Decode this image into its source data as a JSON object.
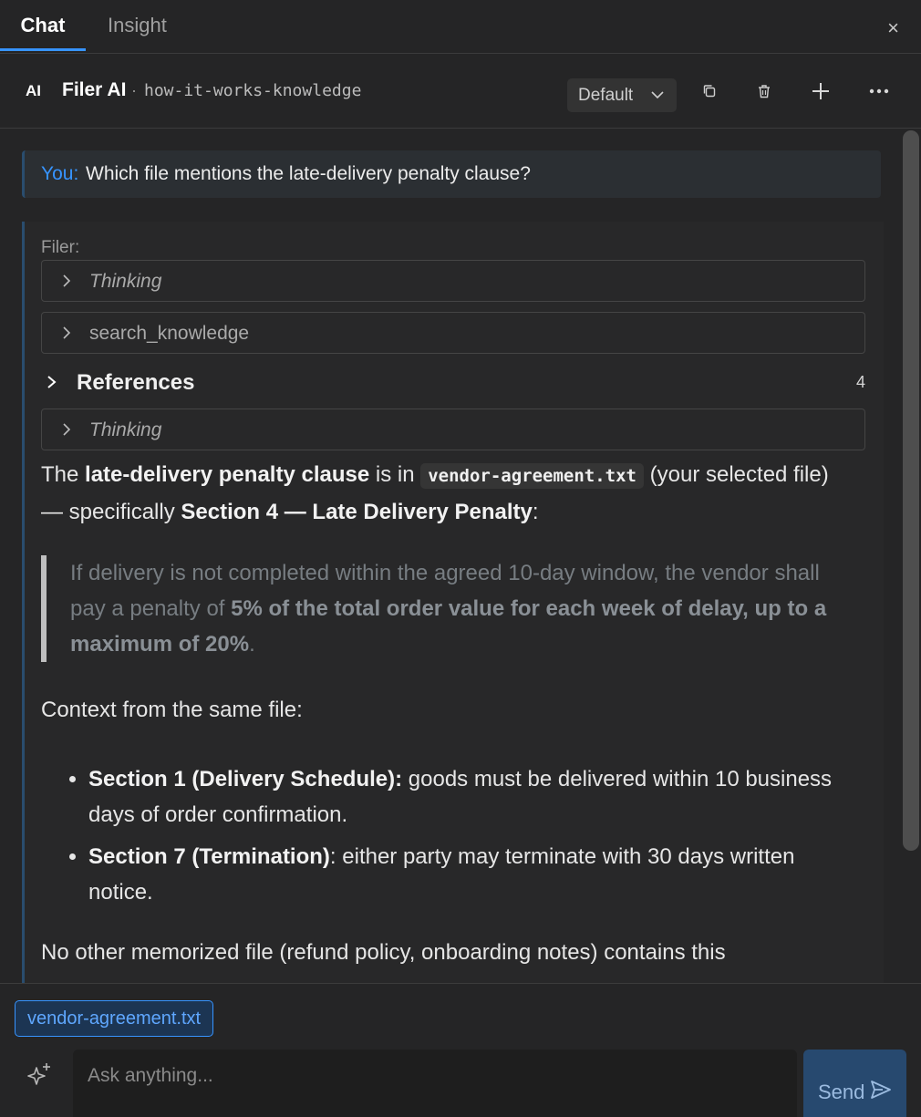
{
  "tabs": {
    "chat": "Chat",
    "insight": "Insight",
    "close": "×"
  },
  "header": {
    "ai_badge": "AI",
    "bot_name": "Filer AI",
    "separator": "·",
    "knowledge_base": "how-it-works-knowledge",
    "mode": "Default"
  },
  "user_message": {
    "prefix": "You:",
    "text": "Which file mentions the late-delivery penalty clause?"
  },
  "ai_message": {
    "sender": "Filer:",
    "thinking_1": "Thinking",
    "tool_call": "search_knowledge",
    "references_label": "References",
    "references_count": "4",
    "thinking_2": "Thinking",
    "answer": {
      "p1": "The ",
      "p1_bold": "late-delivery penalty clause",
      "p2": " is in ",
      "code": "vendor-agreement.txt",
      "p3": " (your selected file) — specifically ",
      "p3_bold": "Section 4 — Late Delivery Penalty",
      "p4": ":"
    },
    "quote": {
      "q1": "If delivery is not completed within the agreed 10-day window, the vendor shall pay a penalty of ",
      "q_bold": "5% of the total order value for each week of delay, up to a maximum of 20%",
      "q2": "."
    },
    "context_heading": "Context from the same file:",
    "bullets": [
      {
        "bold": "Section 1 (Delivery Schedule):",
        "text": " goods must be delivered within 10 business days of order confirmation."
      },
      {
        "bold": "Section 7 (Termination)",
        "text": ": either party may terminate with 30 days written notice."
      }
    ],
    "last_line": "No other memorized file (refund policy, onboarding notes) contains this"
  },
  "composer": {
    "attached_file": "vendor-agreement.txt",
    "placeholder": "Ask anything...",
    "send_label": "Send"
  }
}
